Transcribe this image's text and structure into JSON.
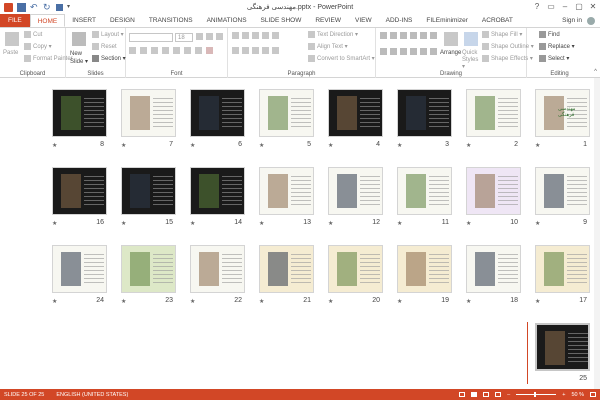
{
  "title_bar": {
    "document_title": "مهندسی فرهنگی.pptx - PowerPoint",
    "window_controls": [
      "?",
      "▭",
      "–",
      "▢",
      "✕"
    ]
  },
  "tabs": {
    "file": "FILE",
    "items": [
      "HOME",
      "INSERT",
      "DESIGN",
      "TRANSITIONS",
      "ANIMATIONS",
      "SLIDE SHOW",
      "REVIEW",
      "VIEW",
      "ADD-INS",
      "FILEminimizer",
      "ACROBAT"
    ],
    "sign_in": "Sign in"
  },
  "ribbon": {
    "clipboard": {
      "paste": "Paste",
      "cut": "Cut",
      "copy": "Copy ▾",
      "format_painter": "Format Painter",
      "label": "Clipboard"
    },
    "slides": {
      "new_slide": "New Slide ▾",
      "layout": "Layout ▾",
      "reset": "Reset",
      "section": "Section ▾",
      "label": "Slides"
    },
    "font": {
      "size": "18",
      "label": "Font"
    },
    "paragraph": {
      "text_direction": "Text Direction ▾",
      "align_text": "Align Text ▾",
      "convert_smartart": "Convert to SmartArt ▾",
      "label": "Paragraph"
    },
    "drawing": {
      "arrange": "Arrange",
      "quick_styles": "Quick Styles ▾",
      "shape_fill": "Shape Fill ▾",
      "shape_outline": "Shape Outline ▾",
      "shape_effects": "Shape Effects ▾",
      "label": "Drawing"
    },
    "editing": {
      "find": "Find",
      "replace": "Replace ▾",
      "select": "Select ▾",
      "label": "Editing"
    }
  },
  "slides": [
    {
      "num": "1"
    },
    {
      "num": "2"
    },
    {
      "num": "3"
    },
    {
      "num": "4"
    },
    {
      "num": "5"
    },
    {
      "num": "6"
    },
    {
      "num": "7"
    },
    {
      "num": "8"
    },
    {
      "num": "9"
    },
    {
      "num": "10"
    },
    {
      "num": "11"
    },
    {
      "num": "12"
    },
    {
      "num": "13"
    },
    {
      "num": "14"
    },
    {
      "num": "15"
    },
    {
      "num": "16"
    },
    {
      "num": "17"
    },
    {
      "num": "18"
    },
    {
      "num": "19"
    },
    {
      "num": "20"
    },
    {
      "num": "21"
    },
    {
      "num": "22"
    },
    {
      "num": "23"
    },
    {
      "num": "24"
    },
    {
      "num": "25"
    }
  ],
  "slide1_title": "مهندسی فرهنگی",
  "status": {
    "slide_info": "SLIDE 25 OF 25",
    "language": "ENGLISH (UNITED STATES)",
    "zoom": "50 %"
  },
  "colors": {
    "accent": "#d24726"
  }
}
